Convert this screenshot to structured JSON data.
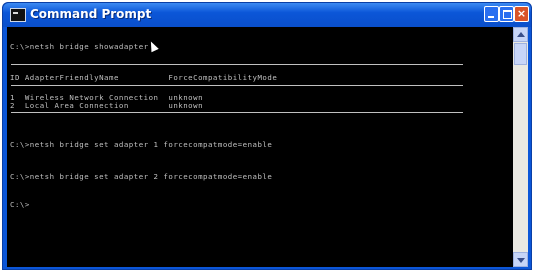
{
  "window": {
    "title": "Command Prompt",
    "minimize_glyph": "",
    "maximize_glyph": "",
    "close_glyph": "×"
  },
  "console": {
    "lines": [
      "C:\\>netsh bridge showadapter",
      "ID AdapterFriendlyName          ForceCompatibilityMode",
      "1  Wireless Network Connection  unknown",
      "2  Local Area Connection        unknown",
      "C:\\>netsh bridge set adapter 1 forcecompatmode=enable",
      "C:\\>netsh bridge set adapter 2 forcecompatmode=enable",
      "C:\\>"
    ]
  },
  "colors": {
    "titlebar": "#0b56d8",
    "console_bg": "#000000",
    "console_text": "#c0c0c0"
  },
  "icons": {
    "app": "cmd-icon",
    "pointer": "mouse-pointer-icon"
  }
}
